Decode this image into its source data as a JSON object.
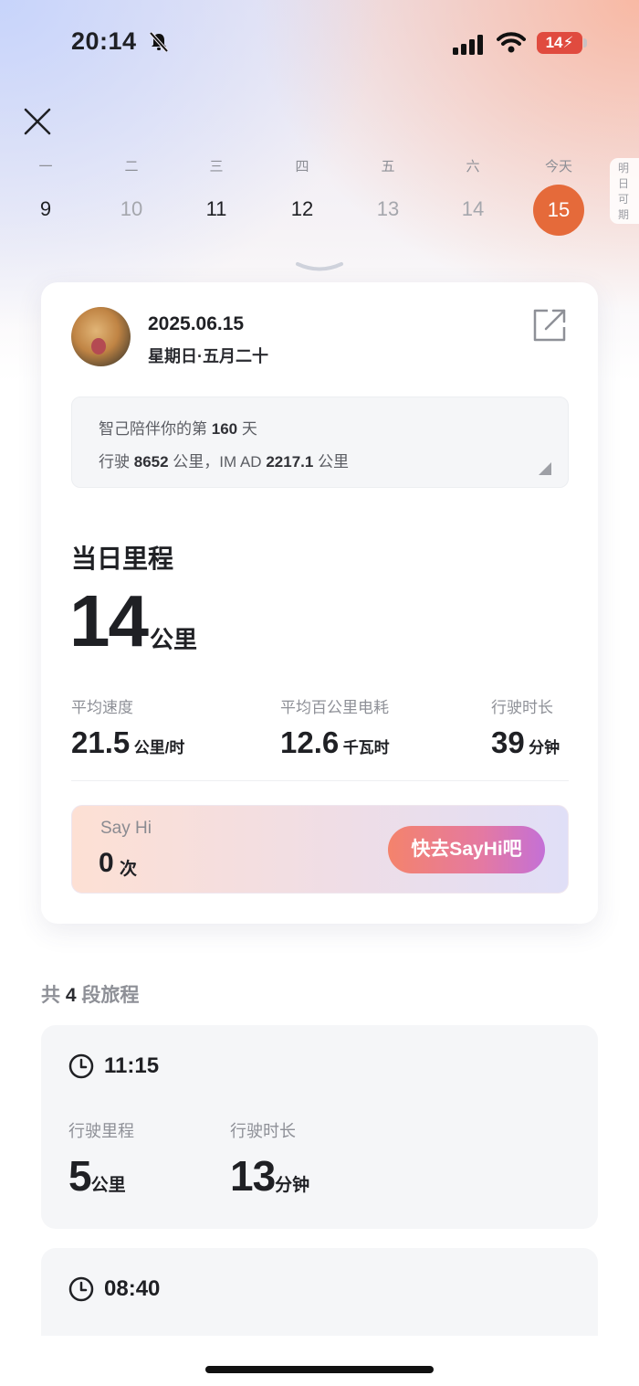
{
  "status": {
    "time": "20:14",
    "battery": "14"
  },
  "week": [
    {
      "label": "一",
      "day": "9",
      "muted": false
    },
    {
      "label": "二",
      "day": "10",
      "muted": true
    },
    {
      "label": "三",
      "day": "11",
      "muted": false
    },
    {
      "label": "四",
      "day": "12",
      "muted": false
    },
    {
      "label": "五",
      "day": "13",
      "muted": true
    },
    {
      "label": "六",
      "day": "14",
      "muted": true
    }
  ],
  "today": {
    "label": "今天",
    "day": "15"
  },
  "tomorrow_label": "明日可期",
  "card": {
    "date": "2025.06.15",
    "weekday": "星期日·五月二十",
    "memo": {
      "line1_prefix": "智己陪伴你的第",
      "line1_days": "160",
      "line1_suffix": "天",
      "line2_prefix": "行驶",
      "line2_total": "8652",
      "line2_mid": "公里，IM AD",
      "line2_ad": "2217.1",
      "line2_suffix": "公里"
    },
    "section_title": "当日里程",
    "mileage": "14",
    "mileage_unit": "公里",
    "stats": [
      {
        "label": "平均速度",
        "value": "21.5",
        "unit": "公里/时"
      },
      {
        "label": "平均百公里电耗",
        "value": "12.6",
        "unit": "千瓦时"
      },
      {
        "label": "行驶时长",
        "value": "39",
        "unit": "分钟"
      }
    ],
    "sayhi": {
      "title": "Say Hi",
      "count": "0",
      "unit": "次",
      "button": "快去SayHi吧"
    }
  },
  "trips": {
    "header_prefix": "共",
    "count": "4",
    "header_suffix": "段旅程",
    "items": [
      {
        "time": "11:15",
        "distance_label": "行驶里程",
        "distance": "5",
        "distance_unit": "公里",
        "duration_label": "行驶时长",
        "duration": "13",
        "duration_unit": "分钟"
      },
      {
        "time": "08:40"
      }
    ]
  },
  "colors": {
    "accent": "#e56a3a",
    "button_start": "#f4836c",
    "button_end": "#c470d6"
  }
}
